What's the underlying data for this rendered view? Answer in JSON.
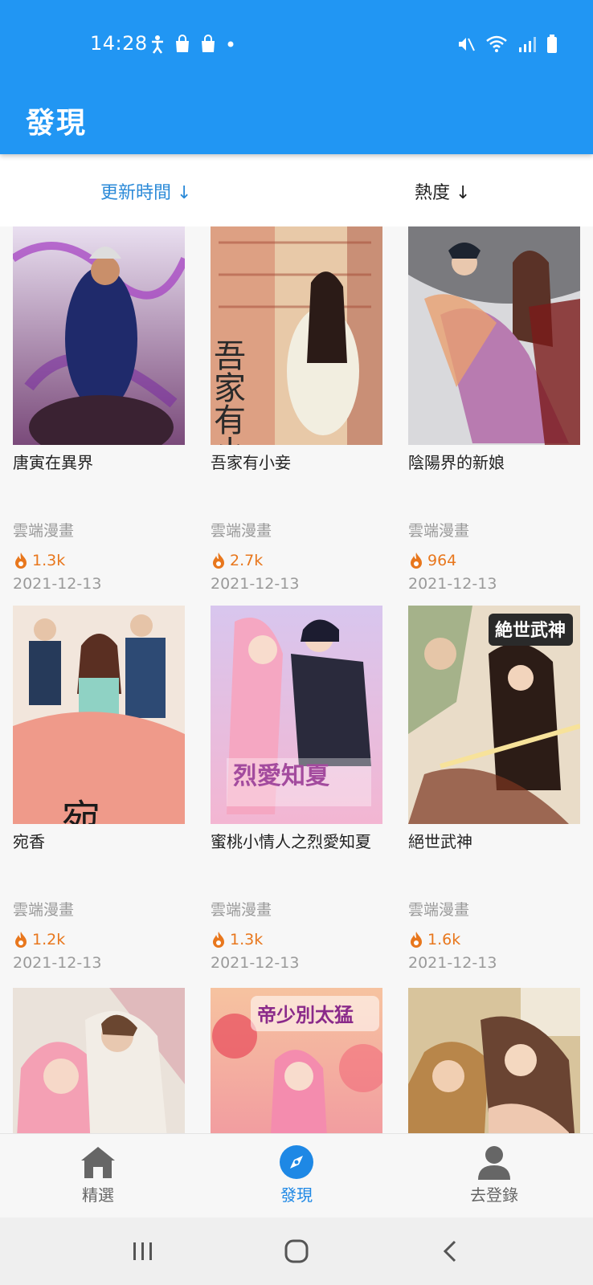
{
  "status_bar": {
    "time": "14:28"
  },
  "app_bar": {
    "title": "發現"
  },
  "sort_tabs": [
    {
      "label": "更新時間 ↓",
      "active": true
    },
    {
      "label": "熱度 ↓",
      "active": false
    }
  ],
  "comics": [
    {
      "title": "唐寅在異界",
      "source": "雲端漫畫",
      "heat": "1.3k",
      "date": "2021-12-13"
    },
    {
      "title": "吾家有小妾",
      "source": "雲端漫畫",
      "heat": "2.7k",
      "date": "2021-12-13"
    },
    {
      "title": "陰陽界的新娘",
      "source": "雲端漫畫",
      "heat": "964",
      "date": "2021-12-13"
    },
    {
      "title": "宛香",
      "source": "雲端漫畫",
      "heat": "1.2k",
      "date": "2021-12-13"
    },
    {
      "title": "蜜桃小情人之烈愛知夏",
      "source": "雲端漫畫",
      "heat": "1.3k",
      "date": "2021-12-13"
    },
    {
      "title": "絕世武神",
      "source": "雲端漫畫",
      "heat": "1.6k",
      "date": "2021-12-13"
    },
    {
      "title": "",
      "source": "",
      "heat": "",
      "date": ""
    },
    {
      "title": "",
      "source": "",
      "heat": "",
      "date": ""
    },
    {
      "title": "",
      "source": "",
      "heat": "",
      "date": ""
    }
  ],
  "cover_text": {
    "c2": "吾家有小妾",
    "c4": "宛香",
    "c5": "烈愛知夏",
    "c6": "絶世武神",
    "c8": "帝少別太猛"
  },
  "bottom_tabs": [
    {
      "label": "精選",
      "icon": "home-icon"
    },
    {
      "label": "發現",
      "icon": "compass-icon",
      "active": true
    },
    {
      "label": "去登錄",
      "icon": "person-icon"
    }
  ],
  "colors": {
    "primary": "#2196f3",
    "heat": "#e8771d",
    "active_tab": "#1e88e5"
  }
}
